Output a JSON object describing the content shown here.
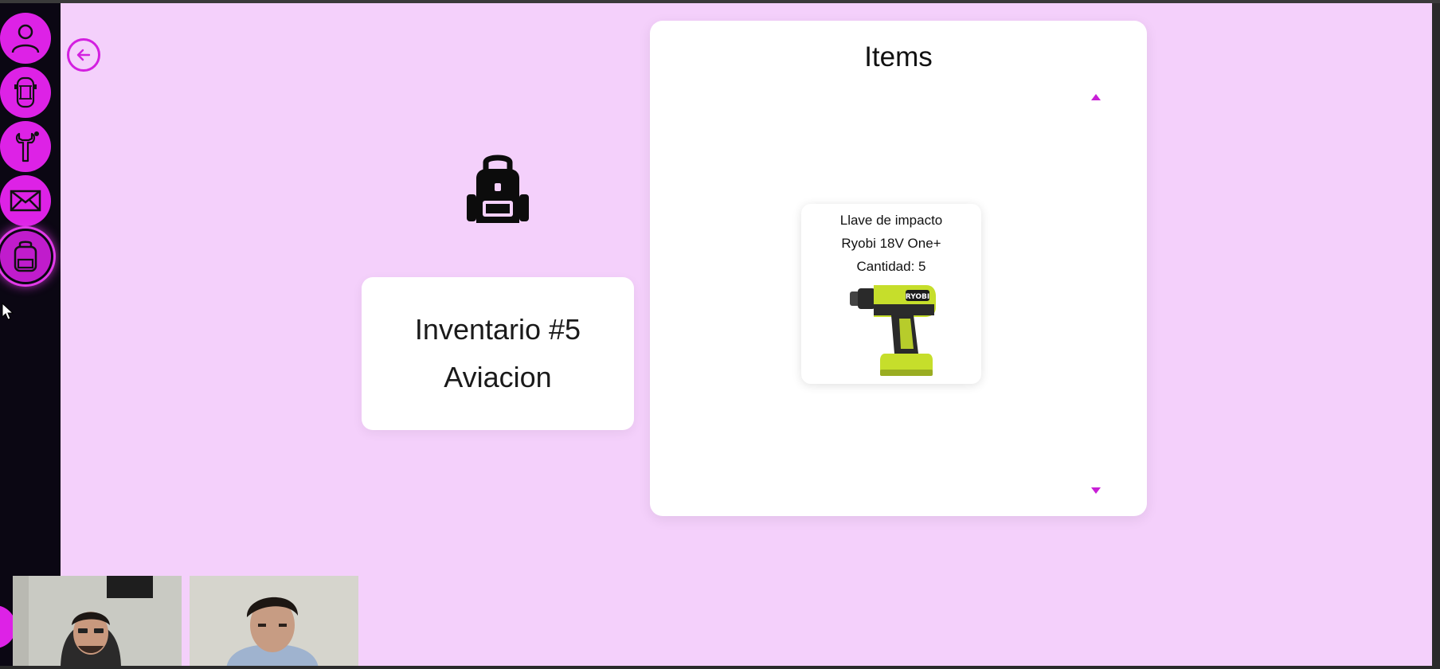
{
  "sidebar": {
    "items": [
      {
        "icon": "user-icon"
      },
      {
        "icon": "car-icon"
      },
      {
        "icon": "wrench-icon"
      },
      {
        "icon": "mail-icon"
      },
      {
        "icon": "backpack-icon",
        "active": true
      }
    ]
  },
  "inventory": {
    "title": "Inventario #5",
    "name": "Aviacion",
    "icon": "backpack-icon"
  },
  "items_panel": {
    "title": "Items",
    "items": [
      {
        "name": "Llave de impacto",
        "name_line2": "Ryobi 18V One+",
        "quantity": "Cantidad: 5",
        "image": "impact-wrench-image"
      }
    ]
  },
  "colors": {
    "accent": "#dd22e6",
    "background": "#f4d0fb",
    "sidebar": "#0b0713",
    "card": "#ffffff"
  },
  "video_call": {
    "participants": [
      "participant-1",
      "participant-2"
    ]
  }
}
